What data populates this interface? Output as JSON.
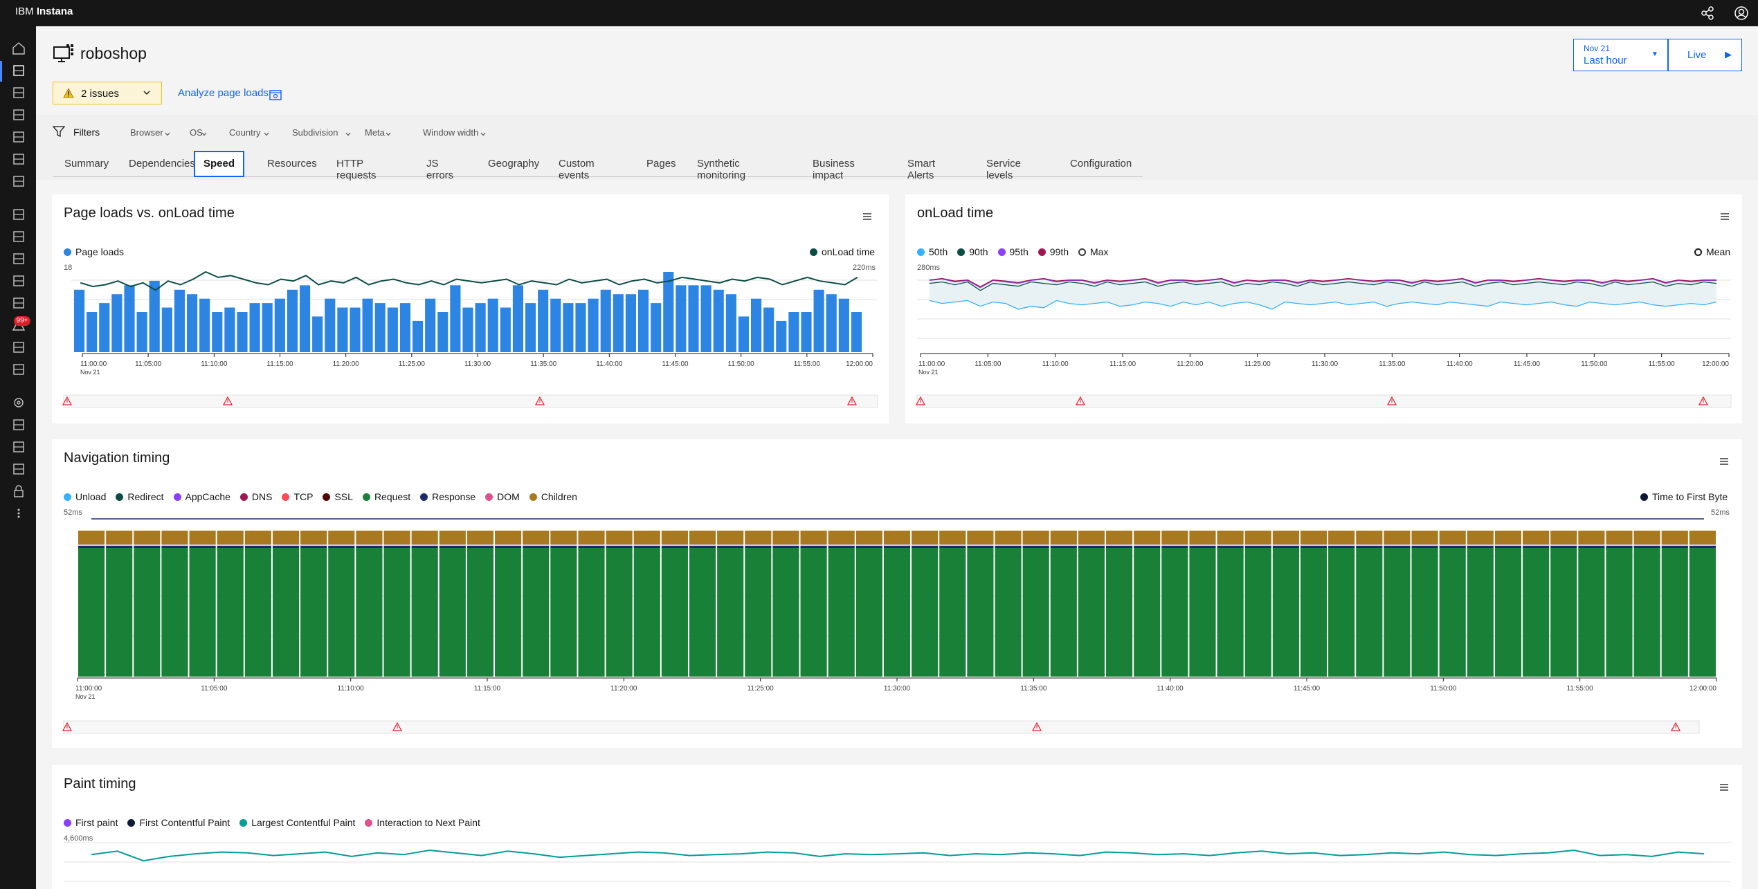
{
  "topbar": {
    "brand_prefix": "IBM",
    "brand_name": "Instana",
    "share_icon": "share-icon",
    "user_icon": "user-icon"
  },
  "sidenav": {
    "icons": [
      "home-icon",
      "websites-icon",
      "mobile-apps-icon",
      "applications-icon",
      "ai-icon",
      "infrastructure-icon",
      "platforms-icon",
      "dashboards-icon",
      "synthetics-icon",
      "deploy-icon",
      "analytics-icon",
      "security-icon",
      "events-icon",
      "automation-icon",
      "sli-icon",
      "settings-icon",
      "agents-icon",
      "pipelines-icon",
      "logs-icon",
      "lock-icon",
      "more-icon"
    ],
    "events_badge": "99+"
  },
  "header": {
    "title": "roboshop",
    "issues_label": "2 issues",
    "analyze_label": "Analyze page loads",
    "time_date": "Nov 21",
    "time_range": "Last hour",
    "live_label": "Live"
  },
  "filters": {
    "label": "Filters",
    "dropdowns": [
      "Browser",
      "OS",
      "Country",
      "Subdivision",
      "Meta",
      "Window width"
    ]
  },
  "tabs": [
    "Summary",
    "Dependencies",
    "Speed",
    "Resources",
    "HTTP requests",
    "JS errors",
    "Geography",
    "Custom events",
    "Pages",
    "Synthetic monitoring",
    "Business impact",
    "Smart Alerts",
    "Service levels",
    "Configuration"
  ],
  "active_tab": "Speed",
  "time_ticks": [
    "11:00:00",
    "11:05:00",
    "11:10:00",
    "11:15:00",
    "11:20:00",
    "11:25:00",
    "11:30:00",
    "11:35:00",
    "11:40:00",
    "11:45:00",
    "11:50:00",
    "11:55:00",
    "12:00:00"
  ],
  "date_label": "Nov 21",
  "colors": {
    "blue_bar": "#2c84e3",
    "dark_teal": "#0b4d45",
    "green": "#198038",
    "gold": "#a87920",
    "navy": "#1c2a6b",
    "cyan": "#33b1ff",
    "purple": "#8a3ffc",
    "maroon": "#9f1853",
    "teal": "#009d9a",
    "pink": "#e0508d"
  },
  "panels": {
    "page_loads": {
      "title": "Page loads vs. onLoad time",
      "legend_left": "Page loads",
      "legend_right": "onLoad time",
      "y_left_max": "18",
      "y_right_max": "220ms"
    },
    "onload": {
      "title": "onLoad time",
      "legend": [
        "50th",
        "90th",
        "95th",
        "99th",
        "Max"
      ],
      "legend_right": "Mean",
      "y_max": "280ms"
    },
    "navigation": {
      "title": "Navigation timing",
      "legend": [
        "Unload",
        "Redirect",
        "AppCache",
        "DNS",
        "TCP",
        "SSL",
        "Request",
        "Response",
        "DOM",
        "Children"
      ],
      "legend_right": "Time to First Byte",
      "y_left_max": "52ms",
      "y_right_max": "52ms"
    },
    "paint": {
      "title": "Paint timing",
      "legend": [
        "First paint",
        "First Contentful Paint",
        "Largest Contentful Paint",
        "Interaction to Next Paint"
      ],
      "y_max": "4,600ms"
    }
  },
  "chart_data": [
    {
      "type": "bar",
      "title": "Page loads vs. onLoad time",
      "x_range": [
        "11:00:00",
        "12:00:00"
      ],
      "series": [
        {
          "name": "Page loads",
          "values": [
            14,
            9,
            11,
            13,
            15,
            9,
            16,
            10,
            14,
            13,
            12,
            9,
            10,
            9,
            11,
            11,
            12,
            14,
            15,
            8,
            12,
            10,
            10,
            12,
            11,
            10,
            11,
            7,
            12,
            9,
            15,
            10,
            11,
            12,
            10,
            15,
            11,
            14,
            12,
            11,
            11,
            12,
            14,
            13,
            13,
            14,
            11,
            18,
            15,
            15,
            15,
            14,
            13,
            8,
            12,
            10,
            7,
            9,
            9,
            14,
            13,
            12,
            9
          ],
          "ylim": [
            0,
            18
          ]
        },
        {
          "name": "onLoad time",
          "values": [
            190,
            180,
            185,
            195,
            180,
            190,
            170,
            195,
            185,
            200,
            220,
            205,
            210,
            200,
            190,
            185,
            200,
            195,
            210,
            185,
            195,
            190,
            205,
            185,
            195,
            200,
            190,
            185,
            195,
            185,
            200,
            195,
            190,
            195,
            200,
            185,
            195,
            190,
            185,
            200,
            190,
            195,
            200,
            185,
            195,
            200,
            190,
            195,
            205,
            200,
            195,
            190,
            200,
            195,
            205,
            200,
            185,
            195,
            205,
            195,
            190,
            185,
            205
          ],
          "ylim": [
            0,
            220
          ]
        }
      ]
    },
    {
      "type": "line",
      "title": "onLoad time",
      "x_range": [
        "11:00:00",
        "12:00:00"
      ],
      "ylim": [
        0,
        280
      ],
      "series": [
        {
          "name": "50th",
          "values": [
            180,
            170,
            175,
            180,
            160,
            175,
            170,
            150,
            160,
            155,
            180,
            170,
            165,
            170,
            175,
            160,
            165,
            175,
            170,
            160,
            175,
            165,
            175,
            160,
            170,
            175,
            165,
            150,
            175,
            170,
            165,
            170,
            175,
            165,
            170,
            175,
            160,
            170,
            175,
            170,
            165,
            175,
            170,
            165,
            160,
            175,
            170,
            165,
            170,
            175,
            165,
            160,
            175,
            170,
            165,
            170,
            175,
            165,
            160,
            165,
            170,
            165,
            175
          ]
        },
        {
          "name": "90th",
          "values": [
            240,
            245,
            235,
            245,
            215,
            240,
            235,
            230,
            245,
            240,
            235,
            245,
            240,
            230,
            245,
            235,
            240,
            245,
            230,
            240,
            245,
            235,
            240,
            245,
            230,
            240,
            235,
            245,
            240,
            230,
            245,
            235,
            240,
            245,
            240,
            235,
            245,
            240,
            230,
            245,
            235,
            240,
            245,
            230,
            240,
            245,
            235,
            240,
            245,
            240,
            235,
            245,
            240,
            230,
            245,
            235,
            240,
            245,
            230,
            240,
            235,
            245,
            240
          ]
        },
        {
          "name": "95th",
          "values": [
            250,
            255,
            245,
            250,
            225,
            250,
            245,
            240,
            250,
            255,
            245,
            250,
            250,
            240,
            250,
            245,
            250,
            255,
            240,
            250,
            250,
            245,
            250,
            255,
            240,
            250,
            245,
            250,
            250,
            240,
            250,
            245,
            250,
            255,
            250,
            245,
            250,
            250,
            240,
            250,
            245,
            250,
            255,
            240,
            250,
            250,
            245,
            250,
            255,
            250,
            245,
            250,
            250,
            240,
            250,
            245,
            250,
            255,
            240,
            250,
            245,
            250,
            250
          ]
        },
        {
          "name": "99th",
          "values": [
            252,
            257,
            248,
            252,
            228,
            252,
            248,
            243,
            252,
            257,
            248,
            252,
            252,
            243,
            252,
            248,
            252,
            257,
            243,
            252,
            252,
            248,
            252,
            257,
            243,
            252,
            248,
            252,
            252,
            243,
            252,
            248,
            252,
            257,
            252,
            248,
            252,
            252,
            243,
            252,
            248,
            252,
            257,
            243,
            252,
            252,
            248,
            252,
            257,
            252,
            248,
            252,
            252,
            243,
            252,
            248,
            252,
            257,
            243,
            252,
            248,
            252,
            252
          ]
        }
      ]
    },
    {
      "type": "bar",
      "title": "Navigation timing",
      "x_range": [
        "11:00:00",
        "12:00:00"
      ],
      "ylim": [
        0,
        52
      ],
      "bar_count": 59,
      "series": [
        {
          "name": "Request",
          "value_each": 40
        },
        {
          "name": "Response",
          "value_each": 1
        },
        {
          "name": "DOM",
          "value_each": 0.5
        },
        {
          "name": "Children",
          "value_each": 5
        },
        {
          "name": "Time to First Byte",
          "value_each": 52
        }
      ]
    },
    {
      "type": "line",
      "title": "Paint timing",
      "ylim": [
        0,
        4600
      ],
      "series": [
        {
          "name": "Largest Contentful Paint",
          "values": [
            3700,
            4100,
            3000,
            3500,
            3800,
            4000,
            3900,
            3600,
            3800,
            4000,
            3500,
            3900,
            3700,
            4200,
            3900,
            3600,
            4100,
            3800,
            3400,
            3600,
            3800,
            4000,
            3900,
            3600,
            3700,
            3800,
            4000,
            3900,
            3500,
            3800,
            3700,
            3800,
            3900,
            3600,
            3800,
            3700,
            3900,
            3800,
            3600,
            4000,
            3900,
            3700,
            3800,
            3600,
            3900,
            4100,
            3800,
            3900,
            3600,
            3700,
            3900,
            3800,
            4000,
            3700,
            3600,
            3800,
            3900,
            4200,
            3600,
            3700,
            3500,
            4000,
            3800
          ]
        }
      ]
    }
  ]
}
